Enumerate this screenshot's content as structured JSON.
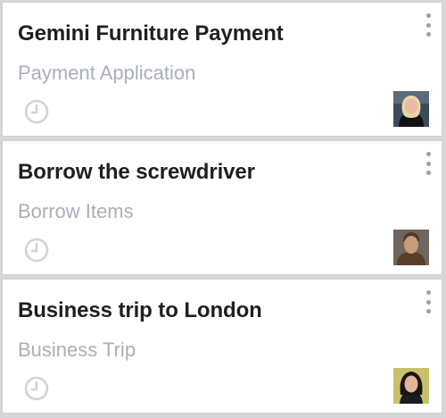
{
  "cards": [
    {
      "title": "Gemini Furniture Payment",
      "subtitle": "Payment Application",
      "status_icon": "clock-icon",
      "menu_icon": "more-vertical-icon",
      "avatar": "user-avatar"
    },
    {
      "title": "Borrow the screwdriver",
      "subtitle": "Borrow Items",
      "status_icon": "clock-icon",
      "menu_icon": "more-vertical-icon",
      "avatar": "user-avatar"
    },
    {
      "title": "Business trip to London",
      "subtitle": "Business Trip",
      "status_icon": "clock-icon",
      "menu_icon": "more-vertical-icon",
      "avatar": "user-avatar"
    }
  ],
  "colors": {
    "title": "#1d1f23",
    "subtitle": "#a8afba",
    "icon": "#d0d3d8",
    "border": "#cfd2d6"
  }
}
